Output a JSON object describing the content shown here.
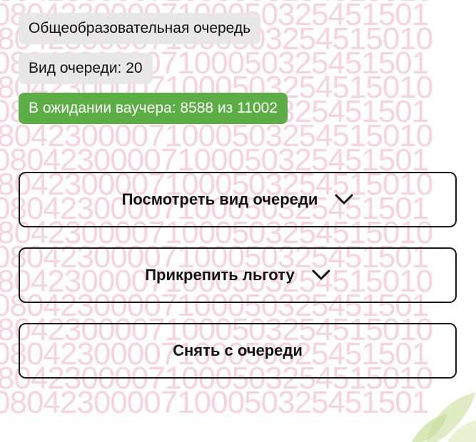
{
  "queue_name": "Общеобразовательная очередь",
  "queue_type": "Вид очереди: 20",
  "voucher_status": "В ожидании ваучера: 8588 из 11002",
  "buttons": {
    "view_queue_type": "Посмотреть вид очереди",
    "attach_benefit": "Прикрепить льготу",
    "remove_from_queue": "Снять с очереди"
  },
  "watermark": {
    "line_a": "80423000071000503254515010",
    "line_b": "08042300007100050325451501"
  },
  "colors": {
    "status_green": "#5cad45",
    "watermark": "#f4c9d6",
    "border": "#1a1a1a"
  },
  "icons": {
    "expand": "chevron-down-icon"
  }
}
